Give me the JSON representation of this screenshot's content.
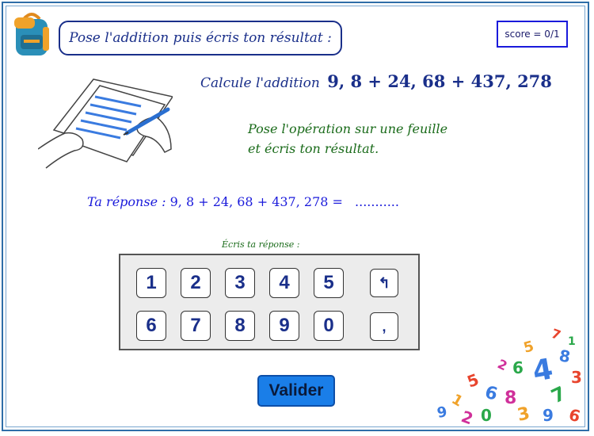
{
  "header": {
    "instruction": "Pose l'addition puis écris ton résultat :",
    "score": "score = 0/1"
  },
  "exercise": {
    "calc_label": "Calcule l'addition",
    "calc_expression": "9, 8 + 24, 68 + 437, 278",
    "pose_line1": "Pose l'opération sur une feuille",
    "pose_line2": "et écris ton résultat.",
    "answer_label": "Ta réponse :",
    "answer_expression": "9, 8 + 24, 68 + 437, 278 =",
    "answer_placeholder": "..........."
  },
  "keypad": {
    "label": "Écris ta réponse :",
    "row1": [
      "1",
      "2",
      "3",
      "4",
      "5"
    ],
    "row2": [
      "6",
      "7",
      "8",
      "9",
      "0"
    ],
    "backspace": "↰",
    "comma": ","
  },
  "submit": {
    "label": "Valider"
  },
  "colors": {
    "title_blue": "#1a2f8a",
    "green_text": "#1a6b1a",
    "answer_blue": "#1a1adb",
    "button_blue": "#1a7ee8"
  }
}
